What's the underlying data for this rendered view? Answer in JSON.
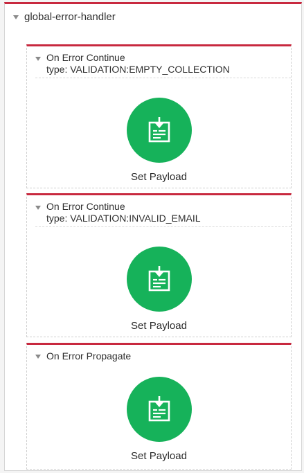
{
  "handler": {
    "title": "global-error-handler"
  },
  "scopes": [
    {
      "title": "On Error Continue",
      "type": "type: VALIDATION:EMPTY_COLLECTION",
      "component": {
        "label": "Set Payload",
        "icon": "set-payload-icon"
      }
    },
    {
      "title": "On Error Continue",
      "type": "type: VALIDATION:INVALID_EMAIL",
      "component": {
        "label": "Set Payload",
        "icon": "set-payload-icon"
      }
    },
    {
      "title": "On Error Propagate",
      "component": {
        "label": "Set Payload",
        "icon": "set-payload-icon"
      }
    }
  ],
  "colors": {
    "accent_red": "#c8293f",
    "component_green": "#16b25a"
  }
}
